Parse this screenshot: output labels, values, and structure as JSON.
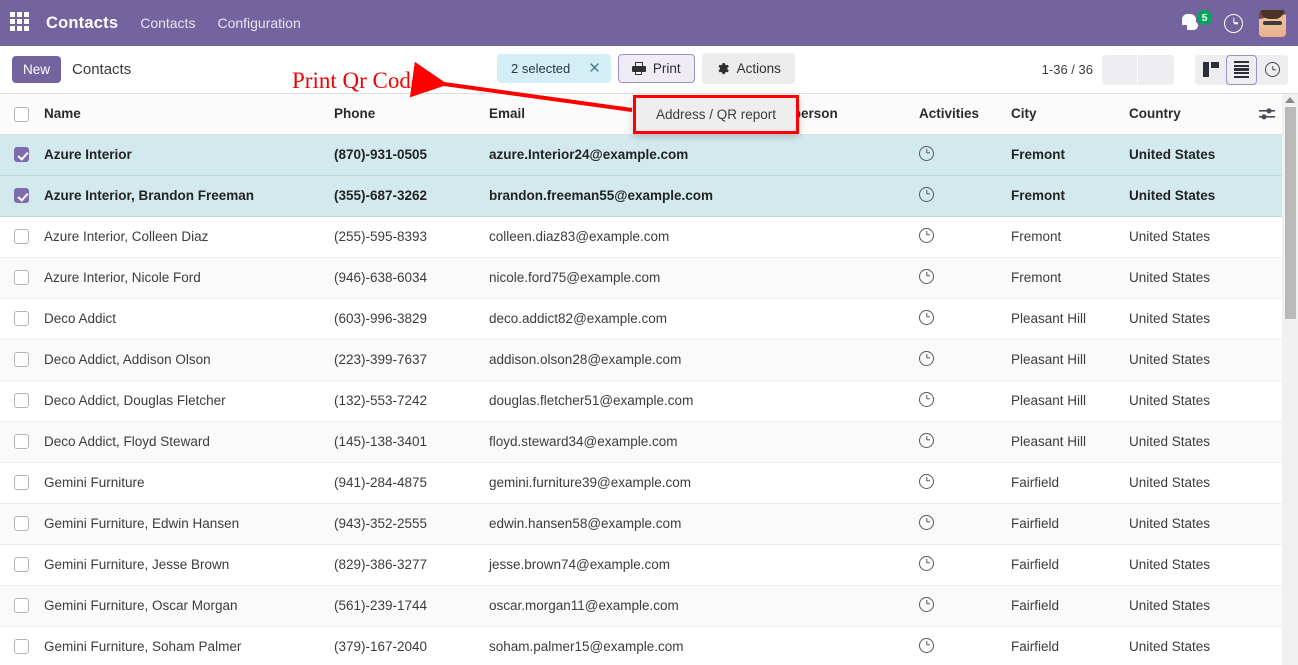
{
  "navbar": {
    "apps_icon": "apps-grid-icon",
    "brand": "Contacts",
    "menus": [
      {
        "label": "Contacts"
      },
      {
        "label": "Configuration"
      }
    ],
    "messages_icon": "chat-bubble-icon",
    "messages_count": "5",
    "activities_icon": "clock-icon",
    "avatar_icon": "user-avatar"
  },
  "control_panel": {
    "new_label": "New",
    "breadcrumb": "Contacts",
    "selection": {
      "label": "2 selected",
      "clear_icon": "close-icon"
    },
    "print_label": "Print",
    "print_icon": "printer-icon",
    "actions_label": "Actions",
    "actions_icon": "gear-icon",
    "pager": "1-36 / 36",
    "views": [
      {
        "name": "kanban",
        "icon": "kanban-icon",
        "active": false
      },
      {
        "name": "list",
        "icon": "list-icon",
        "active": true
      },
      {
        "name": "activity",
        "icon": "clock-icon",
        "active": false
      }
    ]
  },
  "dropdown": {
    "items": [
      {
        "label": "Address / QR report"
      }
    ]
  },
  "annotation": {
    "text": "Print Qr Code",
    "color": "#f30000"
  },
  "table": {
    "columns": [
      "Name",
      "Phone",
      "Email",
      "Salesperson",
      "Activities",
      "City",
      "Country"
    ],
    "salesperson_visible": "lesperson",
    "options_icon": "column-options-icon",
    "rows": [
      {
        "selected": true,
        "name": "Azure Interior",
        "phone": "(870)-931-0505",
        "email": "azure.Interior24@example.com",
        "salesperson": "",
        "city": "Fremont",
        "country": "United States"
      },
      {
        "selected": true,
        "name": "Azure Interior, Brandon Freeman",
        "phone": "(355)-687-3262",
        "email": "brandon.freeman55@example.com",
        "salesperson": "",
        "city": "Fremont",
        "country": "United States"
      },
      {
        "selected": false,
        "name": "Azure Interior, Colleen Diaz",
        "phone": "(255)-595-8393",
        "email": "colleen.diaz83@example.com",
        "salesperson": "",
        "city": "Fremont",
        "country": "United States"
      },
      {
        "selected": false,
        "name": "Azure Interior, Nicole Ford",
        "phone": "(946)-638-6034",
        "email": "nicole.ford75@example.com",
        "salesperson": "",
        "city": "Fremont",
        "country": "United States"
      },
      {
        "selected": false,
        "name": "Deco Addict",
        "phone": "(603)-996-3829",
        "email": "deco.addict82@example.com",
        "salesperson": "",
        "city": "Pleasant Hill",
        "country": "United States"
      },
      {
        "selected": false,
        "name": "Deco Addict, Addison Olson",
        "phone": "(223)-399-7637",
        "email": "addison.olson28@example.com",
        "salesperson": "",
        "city": "Pleasant Hill",
        "country": "United States"
      },
      {
        "selected": false,
        "name": "Deco Addict, Douglas Fletcher",
        "phone": "(132)-553-7242",
        "email": "douglas.fletcher51@example.com",
        "salesperson": "",
        "city": "Pleasant Hill",
        "country": "United States"
      },
      {
        "selected": false,
        "name": "Deco Addict, Floyd Steward",
        "phone": "(145)-138-3401",
        "email": "floyd.steward34@example.com",
        "salesperson": "",
        "city": "Pleasant Hill",
        "country": "United States"
      },
      {
        "selected": false,
        "name": "Gemini Furniture",
        "phone": "(941)-284-4875",
        "email": "gemini.furniture39@example.com",
        "salesperson": "",
        "city": "Fairfield",
        "country": "United States"
      },
      {
        "selected": false,
        "name": "Gemini Furniture, Edwin Hansen",
        "phone": "(943)-352-2555",
        "email": "edwin.hansen58@example.com",
        "salesperson": "",
        "city": "Fairfield",
        "country": "United States"
      },
      {
        "selected": false,
        "name": "Gemini Furniture, Jesse Brown",
        "phone": "(829)-386-3277",
        "email": "jesse.brown74@example.com",
        "salesperson": "",
        "city": "Fairfield",
        "country": "United States"
      },
      {
        "selected": false,
        "name": "Gemini Furniture, Oscar Morgan",
        "phone": "(561)-239-1744",
        "email": "oscar.morgan11@example.com",
        "salesperson": "",
        "city": "Fairfield",
        "country": "United States"
      },
      {
        "selected": false,
        "name": "Gemini Furniture, Soham Palmer",
        "phone": "(379)-167-2040",
        "email": "soham.palmer15@example.com",
        "salesperson": "",
        "city": "Fairfield",
        "country": "United States"
      }
    ]
  }
}
